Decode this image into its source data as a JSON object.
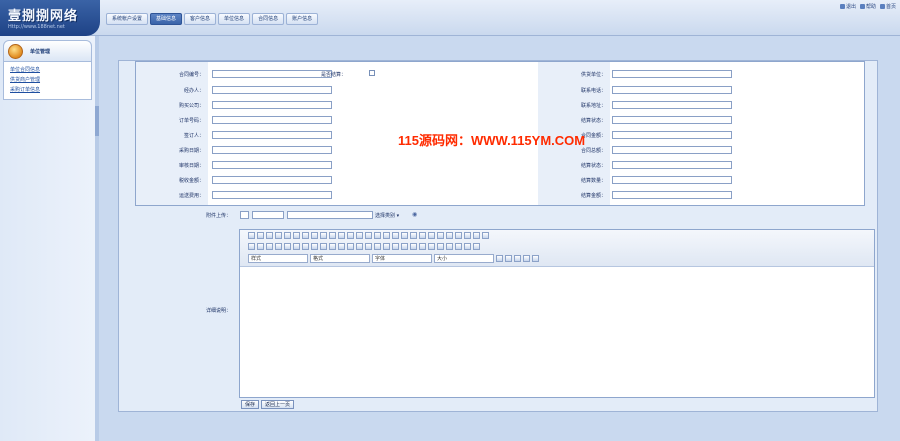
{
  "app": {
    "logo": "壹捌捌网络",
    "logo_url": "Http://www.188net.net"
  },
  "top_right": [
    "退出",
    "帮助",
    "首页"
  ],
  "nav_tabs": [
    {
      "label": "系统帐户设置"
    },
    {
      "label": "基础信息"
    },
    {
      "label": "客户信息"
    },
    {
      "label": "单位信息"
    },
    {
      "label": "合同信息"
    },
    {
      "label": "账户信息"
    }
  ],
  "sidebar": {
    "title": "单位管理",
    "items": [
      "单位合同信息",
      "供货商户管理",
      "采购订单信息"
    ]
  },
  "form": {
    "left_labels": [
      "合同编号：",
      "经办人：",
      "购买公司：",
      "订单号码：",
      "签订人：",
      "采购日期：",
      "审核日期：",
      "税收金额：",
      "运送费用："
    ],
    "right_labels": [
      "供货单位：",
      "联系电话：",
      "联系地址：",
      "结算状态：",
      "合同金额：",
      "合同总额：",
      "结算状态：",
      "结算数量：",
      "结算金额："
    ],
    "mid_label": "是否结算：",
    "left_values": [
      "",
      "",
      "",
      "",
      "",
      "",
      "",
      "",
      ""
    ],
    "right_values": [
      "",
      "",
      "",
      "",
      "",
      "",
      "",
      "",
      ""
    ],
    "watermark": "115源码网：WWW.115YM.COM",
    "attach_label": "附件上传：",
    "attach_hint": "选择类别 ▾",
    "content_label": "详细说明："
  },
  "editor": {
    "selects": [
      "样式",
      "格式",
      "字体",
      "大小"
    ]
  },
  "buttons": {
    "save": "保存",
    "back": "返回上一页"
  },
  "colors": {
    "accent": "#3963a9",
    "page_bg": "#c9d9ef",
    "watermark": "#ff2b00"
  }
}
